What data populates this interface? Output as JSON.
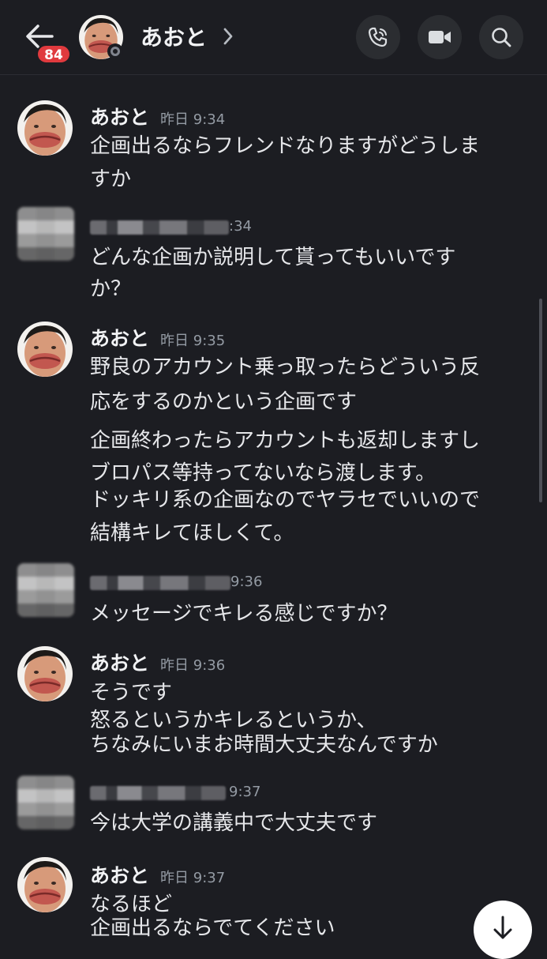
{
  "header": {
    "unread_badge": "84",
    "contact_name": "あおと",
    "icons": {
      "back": "arrow-left-icon",
      "status": "status-offline-icon",
      "chevron": "chevron-right-icon",
      "call": "phone-call-icon",
      "video": "video-camera-icon",
      "search": "search-icon"
    }
  },
  "messages": [
    {
      "author": "あおと",
      "time": "昨日 9:34",
      "lines": [
        "企画出るならフレンドなりますがどうしま",
        "すか"
      ]
    },
    {
      "author": "",
      "time": ":34",
      "author_redacted": true,
      "lines": [
        "どんな企画か説明して貰ってもいいです",
        "か？"
      ]
    },
    {
      "author": "あおと",
      "time": "昨日 9:35",
      "lines": [
        "野良のアカウント乗っ取ったらどういう反",
        "応をするのかという企画です",
        "企画終わったらアカウントも返却しますし",
        "ブロパス等持ってないなら渡します。",
        "ドッキリ系の企画なのでヤラセでいいので",
        "結構キレてほしくて。"
      ]
    },
    {
      "author": "",
      "time": "9:36",
      "author_redacted": true,
      "lines": [
        "メッセージでキレる感じですか？"
      ]
    },
    {
      "author": "あおと",
      "time": "昨日 9:36",
      "lines": [
        "そうです",
        "怒るというかキレるというか、",
        "ちなみにいまお時間大丈夫なんですか"
      ]
    },
    {
      "author": "",
      "time": "9:37",
      "author_redacted": true,
      "lines": [
        "今は大学の講義中で大丈夫です"
      ]
    },
    {
      "author": "あおと",
      "time": "昨日 9:37",
      "lines": [
        "なるほど",
        "企画出るならでてください"
      ]
    }
  ],
  "jump_button_icon": "arrow-down-icon",
  "colors": {
    "background": "#1c1d22",
    "badge": "#e03a3e",
    "timestamp": "#949ba4",
    "text": "#e6e7ea"
  }
}
